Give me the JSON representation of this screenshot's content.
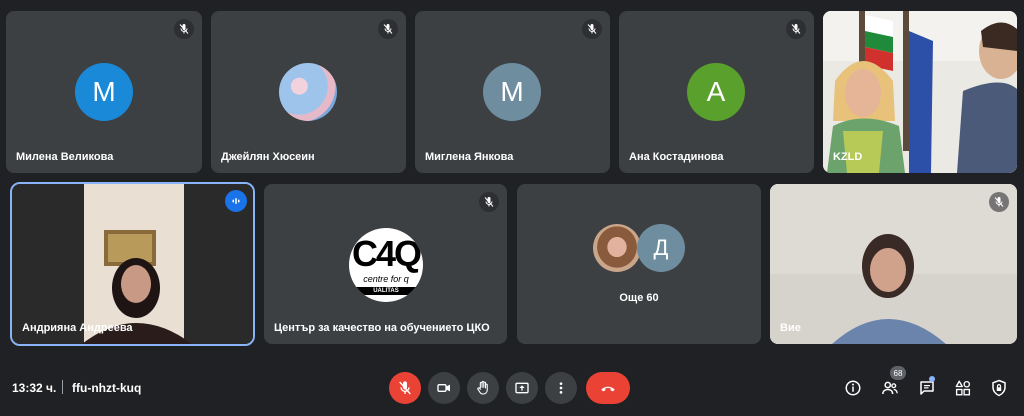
{
  "participants_row1": [
    {
      "name": "Милена Великова",
      "initial": "M",
      "color": "#1a8ad8",
      "muted": true
    },
    {
      "name": "Джейлян Хюсеин",
      "initial": "",
      "color": "#7ea7d8",
      "muted": true
    },
    {
      "name": "Миглена Янкова",
      "initial": "M",
      "color": "#6e8ea0",
      "muted": true
    },
    {
      "name": "Ана Костадинова",
      "initial": "A",
      "color": "#5aa02c",
      "muted": true
    },
    {
      "name": "KZLD",
      "muted": false
    }
  ],
  "participants_row2": [
    {
      "name": "Андрияна Андреева",
      "speaking": true
    },
    {
      "name": "Център за качество на обучението ЦКО",
      "muted": true
    },
    {
      "name": "Още 60",
      "extra_initial": "Д",
      "extra_color": "#6e8ea0"
    },
    {
      "name": "Вие",
      "muted": true
    }
  ],
  "logo_text": {
    "main": "C4Q",
    "sub": "centre for q",
    "bottom": "UALITAS"
  },
  "bottom_bar": {
    "time": "13:32 ч.",
    "meeting_code": "ffu-nhzt-kuq",
    "people_count": "68"
  },
  "colors": {
    "background": "#202124",
    "tile": "#3c4043",
    "accent": "#8ab4f8",
    "danger": "#ea4335"
  }
}
